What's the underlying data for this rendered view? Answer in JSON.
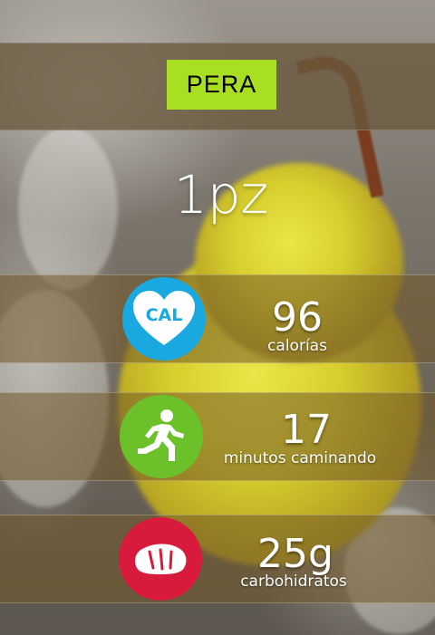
{
  "food": {
    "name": "PERA",
    "quantity": "1pz"
  },
  "stats": [
    {
      "icon": "heart-cal-icon",
      "icon_text": "CAL",
      "value": "96",
      "label": "calorías",
      "color": "#1aa8e0"
    },
    {
      "icon": "running-person-icon",
      "value": "17",
      "label": "minutos caminando",
      "color": "#6cc12a"
    },
    {
      "icon": "bread-icon",
      "value": "25g",
      "label": "carbohidratos",
      "color": "#d81a3c"
    }
  ],
  "colors": {
    "title_box": "#a8df22",
    "title_band": "#69583e",
    "stat_band": "#735a28"
  }
}
